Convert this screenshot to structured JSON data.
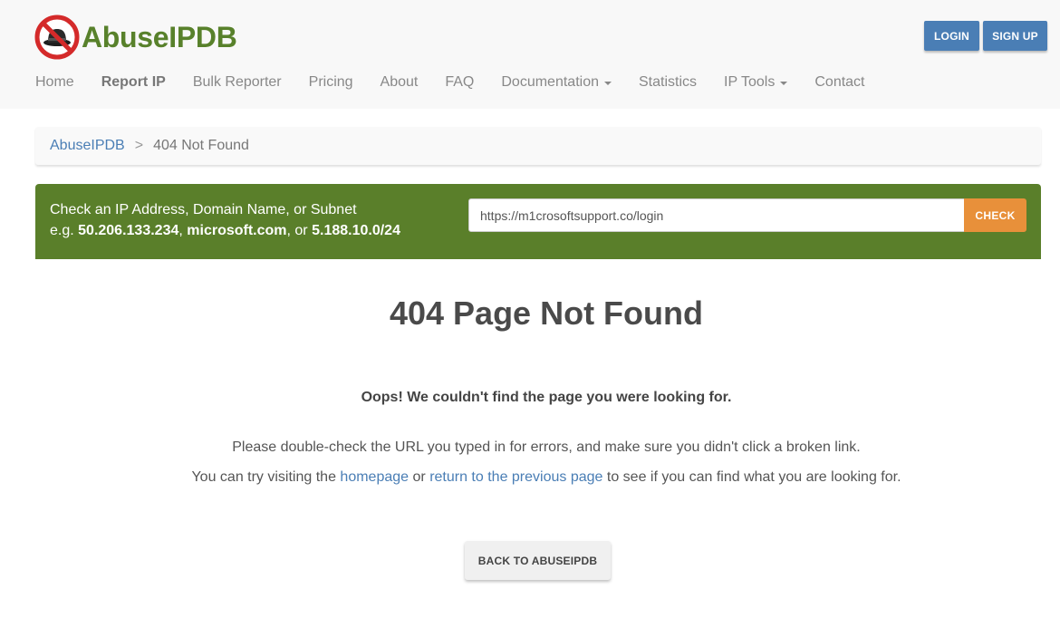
{
  "brand": {
    "name": "AbuseIPDB",
    "color": "#58812b"
  },
  "auth": {
    "login_label": "LOGIN",
    "signup_label": "SIGN UP"
  },
  "nav": {
    "home": "Home",
    "report_ip": "Report IP",
    "bulk_reporter": "Bulk Reporter",
    "pricing": "Pricing",
    "about": "About",
    "faq": "FAQ",
    "documentation": "Documentation",
    "statistics": "Statistics",
    "ip_tools": "IP Tools",
    "contact": "Contact"
  },
  "breadcrumb": {
    "root": "AbuseIPDB",
    "separator": ">",
    "current": "404 Not Found"
  },
  "check": {
    "heading": "Check an IP Address, Domain Name, or Subnet",
    "example_prefix": "e.g.",
    "example_ip": "50.206.133.234",
    "sep1": ",",
    "example_domain": "microsoft.com",
    "sep2": ", or",
    "example_subnet": "5.188.10.0/24",
    "input_value": "https://m1crosoftsupport.co/login",
    "button_label": "CHECK",
    "panel_color": "#5a7f2a",
    "button_color": "#e8903a"
  },
  "main": {
    "title": "404 Page Not Found",
    "oops": "Oops! We couldn't find the page you were looking for.",
    "para1": "Please double-check the URL you typed in for errors, and make sure you didn't click a broken link.",
    "para2_pre": "You can try visiting the",
    "homepage_link": "homepage",
    "para2_mid": "or",
    "previous_link": "return to the previous page",
    "para2_post": "to see if you can find what you are looking for.",
    "back_button": "BACK TO ABUSEIPDB"
  }
}
